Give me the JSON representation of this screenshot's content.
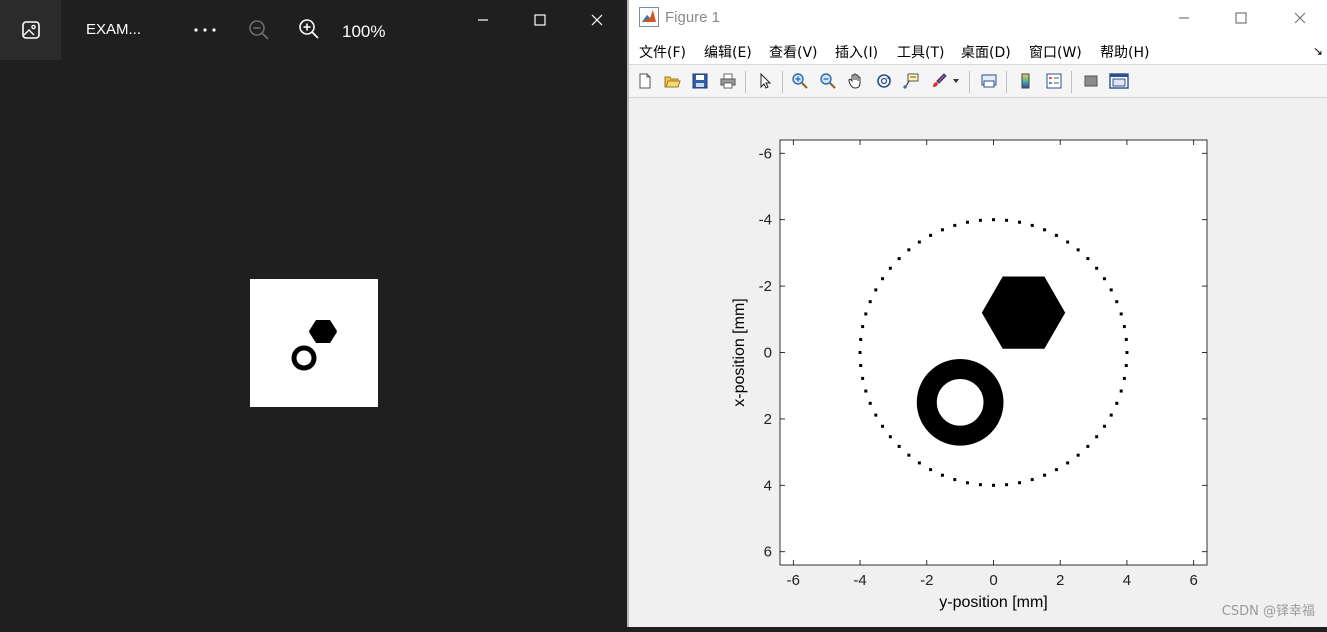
{
  "viewer": {
    "title": "EXAM...",
    "zoom_level": "100%",
    "more_label": "···",
    "icons": [
      "photos-app-icon",
      "more-icon",
      "zoom-out-icon",
      "zoom-in-icon",
      "minimize-icon",
      "maximize-icon",
      "close-icon"
    ]
  },
  "figure": {
    "title": "Figure 1",
    "menu": [
      "文件(F)",
      "编辑(E)",
      "查看(V)",
      "插入(I)",
      "工具(T)",
      "桌面(D)",
      "窗口(W)",
      "帮助(H)"
    ],
    "menu_arrow": "↘",
    "toolbar": [
      "new-figure",
      "open-file",
      "save",
      "print",
      "edit-plot",
      "zoom-in",
      "zoom-out",
      "pan",
      "rotate-3d",
      "data-cursor",
      "brush",
      "link-plot",
      "colorbar",
      "legend",
      "hide-plot-tools",
      "show-plot-tools"
    ],
    "watermark": "CSDN @铎幸福"
  },
  "chart_data": {
    "type": "image",
    "xlabel": "y-position [mm]",
    "ylabel": "x-position [mm]",
    "xlim": [
      -6.4,
      6.4
    ],
    "ylim": [
      -6.4,
      6.4
    ],
    "y_reversed": true,
    "xticks": [
      -6,
      -4,
      -2,
      0,
      2,
      4,
      6
    ],
    "yticks": [
      -6,
      -4,
      -2,
      0,
      2,
      4,
      6
    ],
    "xtick_labels": [
      "-6",
      "-4",
      "-2",
      "0",
      "2",
      "4",
      "6"
    ],
    "ytick_labels": [
      "-6",
      "-4",
      "-2",
      "0",
      "2",
      "4",
      "6"
    ],
    "objects": [
      {
        "kind": "dotted-circle",
        "center": [
          0,
          0
        ],
        "radius": 4,
        "points": 64
      },
      {
        "kind": "filled-hexagon",
        "center": [
          0.9,
          -1.2
        ],
        "radius": 1.25
      },
      {
        "kind": "annulus",
        "center": [
          -1,
          1.5
        ],
        "outer_radius": 1.3,
        "inner_radius": 0.7
      }
    ],
    "colors": {
      "foreground": "#000000",
      "background": "#ffffff"
    }
  }
}
